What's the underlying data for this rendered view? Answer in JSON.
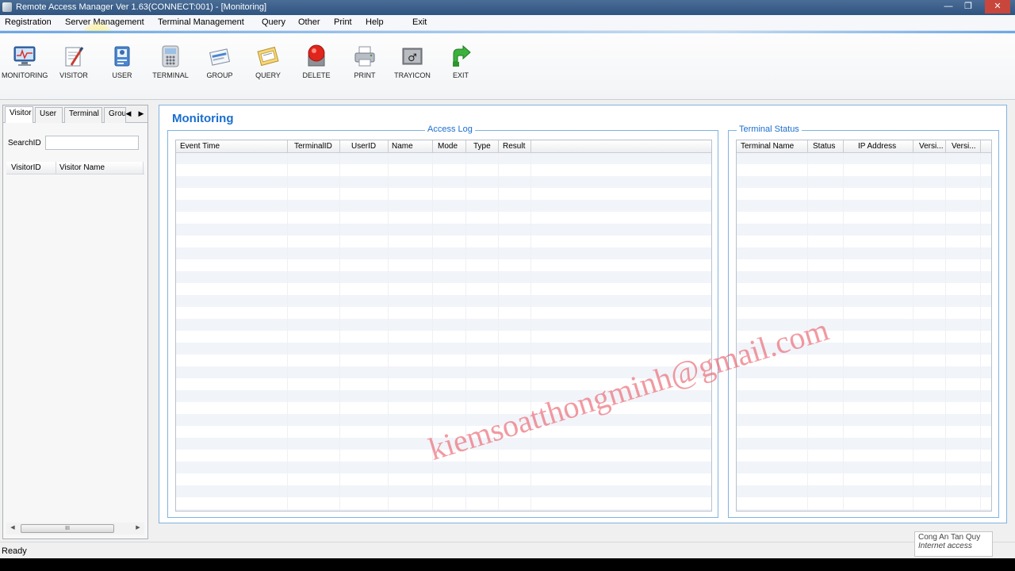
{
  "window": {
    "title": "Remote Access Manager Ver 1.63(CONNECT:001) - [Monitoring]",
    "controls": {
      "minimize": "—",
      "maximize": "❐",
      "close": "✕"
    }
  },
  "menu": [
    "Registration",
    "Server Management",
    "Terminal Management",
    "Query",
    "Other",
    "Print",
    "Help",
    "Exit"
  ],
  "toolbar": [
    {
      "label": "MONITORING",
      "icon": "monitor-icon"
    },
    {
      "label": "VISITOR",
      "icon": "visitor-icon"
    },
    {
      "label": "USER",
      "icon": "user-icon"
    },
    {
      "label": "TERMINAL",
      "icon": "terminal-icon"
    },
    {
      "label": "GROUP",
      "icon": "group-icon"
    },
    {
      "label": "QUERY",
      "icon": "query-icon"
    },
    {
      "label": "DELETE",
      "icon": "delete-icon"
    },
    {
      "label": "PRINT",
      "icon": "printer-icon"
    },
    {
      "label": "TRAYICON",
      "icon": "tray-icon"
    },
    {
      "label": "EXIT",
      "icon": "exit-icon"
    }
  ],
  "left": {
    "tabs": [
      "Visitor",
      "User",
      "Terminal",
      "Grou"
    ],
    "search_label": "SearchID",
    "search_value": "",
    "columns": [
      "VisitorID",
      "Visitor Name"
    ],
    "scroll_thumb": "III"
  },
  "main": {
    "title": "Monitoring",
    "access_log": {
      "title": "Access Log",
      "columns": [
        "Event Time",
        "TerminalID",
        "UserID",
        "Name",
        "Mode",
        "Type",
        "Result"
      ]
    },
    "terminal_status": {
      "title": "Terminal Status",
      "columns": [
        "Terminal Name",
        "Status",
        "IP Address",
        "Versi...",
        "Versi..."
      ]
    }
  },
  "status": "Ready",
  "notification": {
    "line1": "Cong An Tan Quy",
    "line2": "Internet access"
  },
  "watermark": "kiemsoatthongminh@gmail.com",
  "colors": {
    "accent": "#1a6ecf",
    "title_bar": "#2f5480",
    "watermark": "#eb646e"
  }
}
